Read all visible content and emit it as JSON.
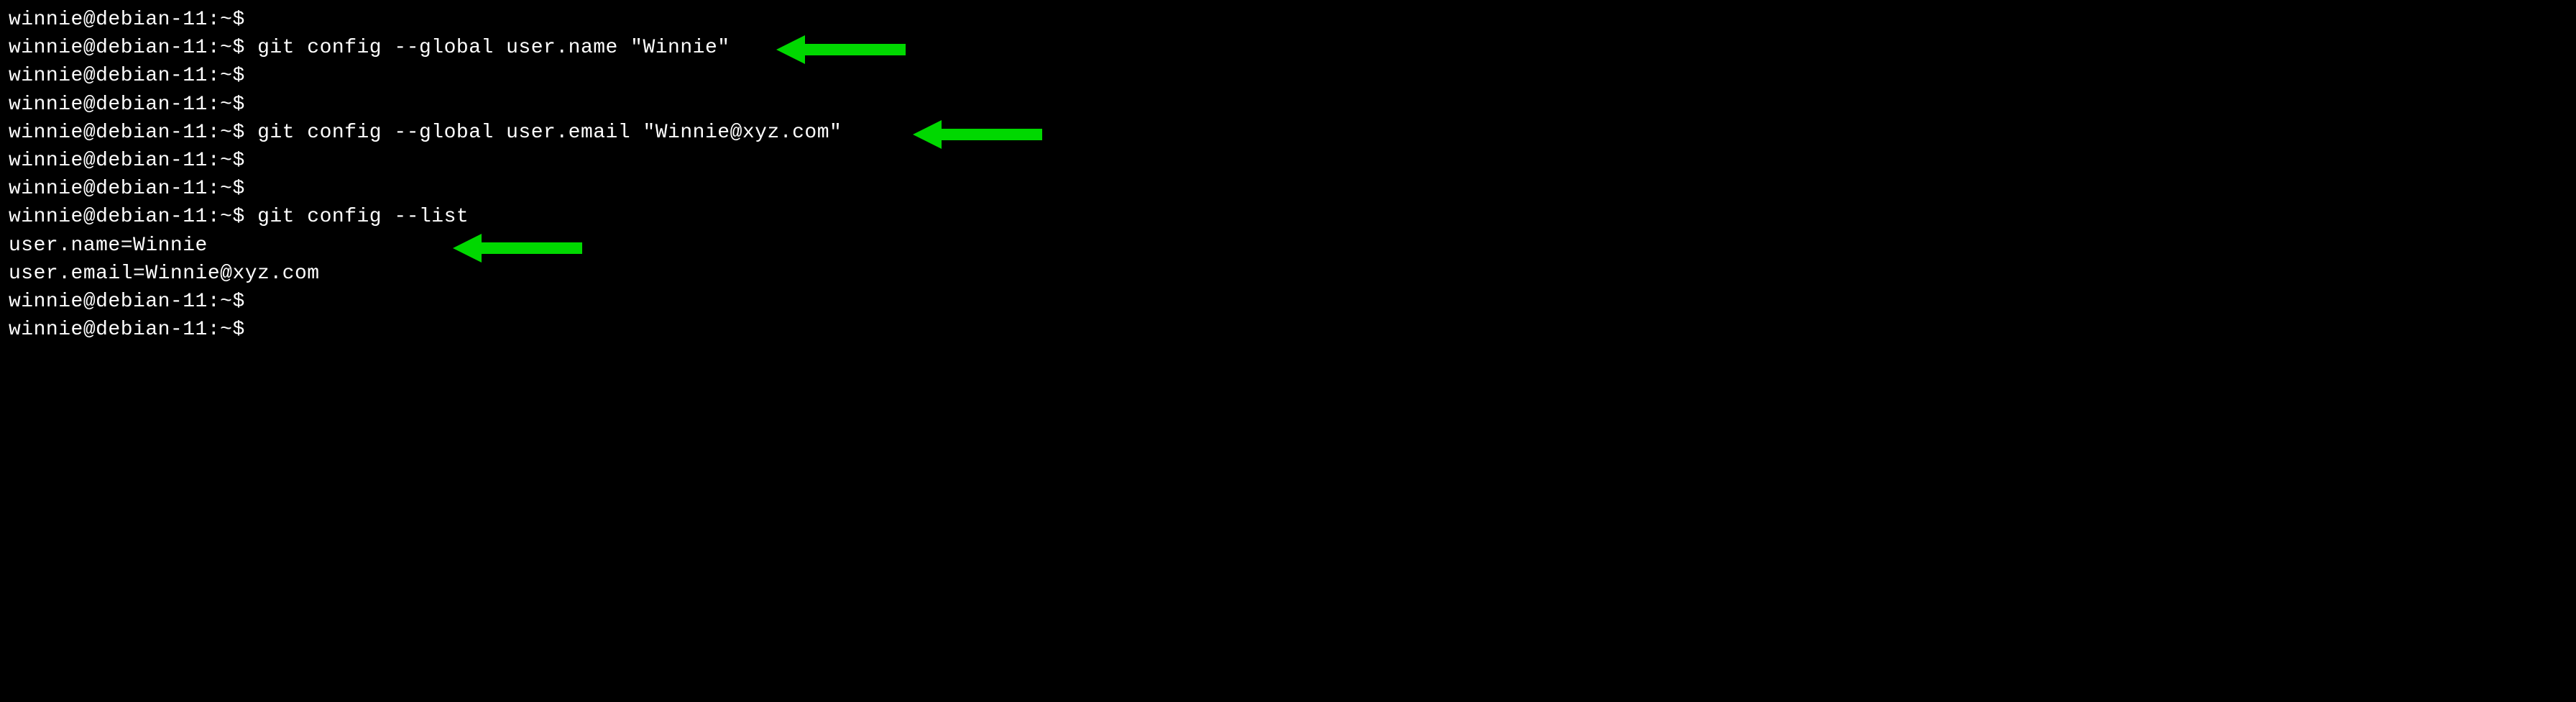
{
  "terminal": {
    "prompt": "winnie@debian-11:~$",
    "lines": [
      {
        "prompt": "winnie@debian-11:~$",
        "command": ""
      },
      {
        "prompt": "winnie@debian-11:~$",
        "command": " git config --global user.name \"Winnie\""
      },
      {
        "prompt": "winnie@debian-11:~$",
        "command": ""
      },
      {
        "prompt": "winnie@debian-11:~$",
        "command": ""
      },
      {
        "prompt": "winnie@debian-11:~$",
        "command": " git config --global user.email \"Winnie@xyz.com\""
      },
      {
        "prompt": "winnie@debian-11:~$",
        "command": ""
      },
      {
        "prompt": "winnie@debian-11:~$",
        "command": ""
      },
      {
        "prompt": "winnie@debian-11:~$",
        "command": " git config --list"
      }
    ],
    "output": [
      "user.name=Winnie",
      "user.email=Winnie@xyz.com"
    ],
    "trailing_prompts": [
      {
        "prompt": "winnie@debian-11:~$",
        "command": ""
      },
      {
        "prompt": "winnie@debian-11:~$",
        "command": ""
      }
    ]
  },
  "annotations": {
    "arrow_color": "#00d800"
  }
}
